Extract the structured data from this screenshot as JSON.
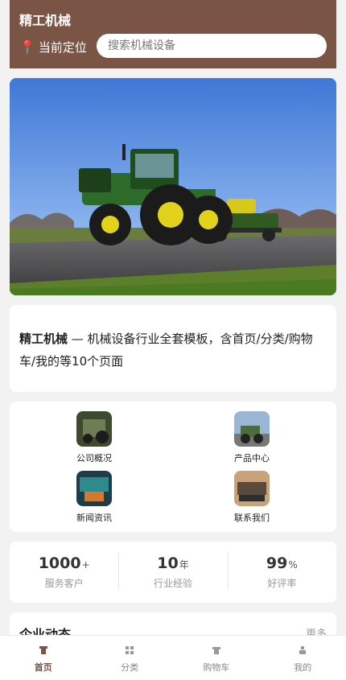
{
  "header": {
    "brand": "精工机械",
    "location_label": "当前定位",
    "search_placeholder": "搜索机械设备"
  },
  "intro": {
    "brand": "精工机械",
    "text": " — 机械设备行业全套模板，含首页/分类/购物车/我的等10个页面"
  },
  "grid": {
    "items": [
      {
        "label": "公司概况"
      },
      {
        "label": "产品中心"
      },
      {
        "label": "新闻资讯"
      },
      {
        "label": "联系我们"
      }
    ]
  },
  "stats": [
    {
      "value": "1000",
      "unit": "+",
      "caption": "服务客户"
    },
    {
      "value": "10",
      "unit": "年",
      "caption": "行业经验"
    },
    {
      "value": "99",
      "unit": "%",
      "caption": "好评率"
    }
  ],
  "news": {
    "title": "企业动态",
    "more": "更多"
  },
  "tabbar": {
    "items": [
      {
        "label": "首页",
        "icon": "home-icon",
        "active": true
      },
      {
        "label": "分类",
        "icon": "grid-icon"
      },
      {
        "label": "购物车",
        "icon": "cart-icon"
      },
      {
        "label": "我的",
        "icon": "user-icon"
      }
    ]
  },
  "colors": {
    "brand": "#7a5546",
    "pin": "#e5453a"
  }
}
